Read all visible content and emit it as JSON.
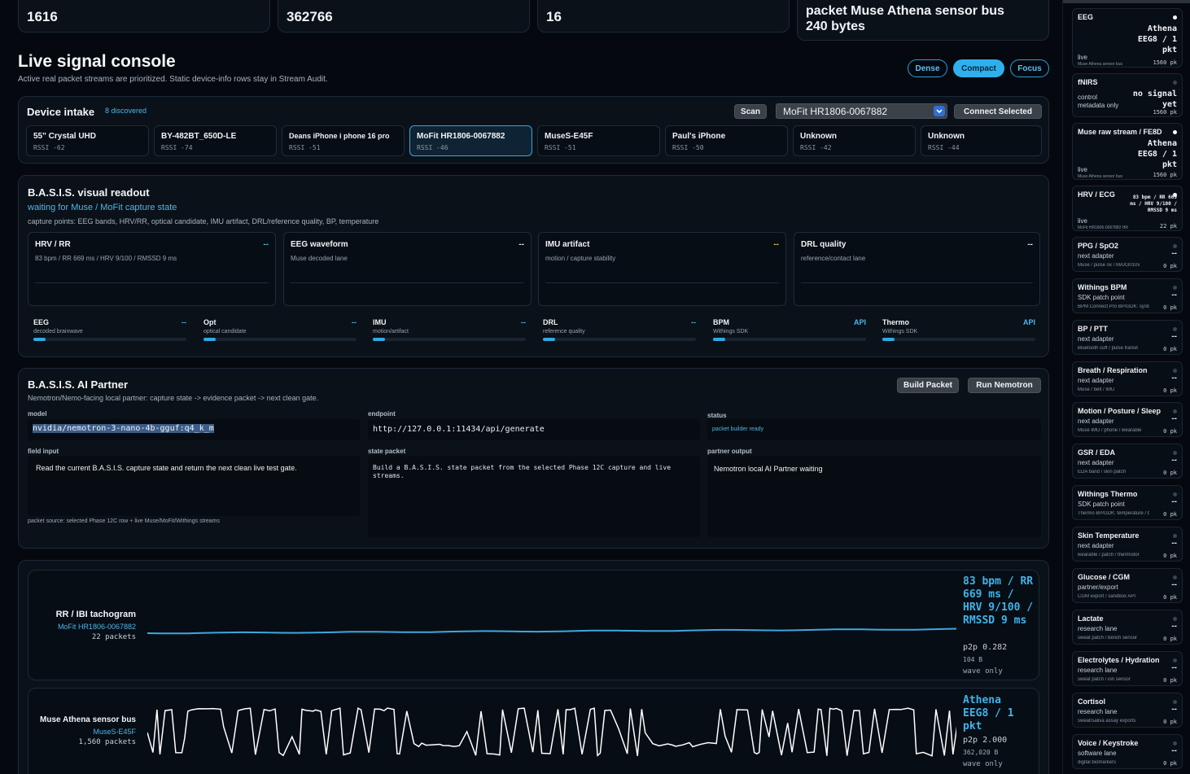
{
  "stats": [
    {
      "value": "1616"
    },
    {
      "value": "362766"
    },
    {
      "value": "16"
    }
  ],
  "last_packet": {
    "line1": "packet Muse Athena sensor bus",
    "line2": "240 bytes"
  },
  "header": {
    "title": "Live signal console",
    "subtitle": "Active real packet streams are prioritized. Static device-info rows stay in Stream Audit."
  },
  "view_modes": {
    "dense": "Dense",
    "compact": "Compact",
    "focus": "Focus",
    "active": "Compact"
  },
  "intake": {
    "title": "Device intake",
    "discovered": "8 discovered",
    "scan_label": "Scan",
    "selected_device": "MoFit HR1806-0067882",
    "connect_label": "Connect Selected",
    "devices": [
      {
        "name": "55\" Crystal UHD",
        "rssi": "RSSI -62"
      },
      {
        "name": "BY-482BT_650D-LE",
        "rssi": "RSSI -74"
      },
      {
        "name": "Deans iPhone i phone 16 pro",
        "rssi": "RSSI -51"
      },
      {
        "name": "MoFit HR1806-0067882",
        "rssi": "RSSI -46",
        "selected": true
      },
      {
        "name": "MuseS-E45F",
        "rssi": "RSSI -51"
      },
      {
        "name": "Paul's iPhone",
        "rssi": "RSSI -50"
      },
      {
        "name": "Unknown",
        "rssi": "RSSI -42"
      },
      {
        "name": "Unknown",
        "rssi": "RSSI -44"
      }
    ]
  },
  "visual": {
    "title": "B.A.S.I.S. visual readout",
    "state": "waiting for Muse / MoFit capture state",
    "capture_points": "capture points: EEG bands, HRV/RR, optical candidate, IMU artifact, DRL/reference quality, BP, temperature",
    "lanes": [
      {
        "title": "HRV / RR",
        "sub": "83 bpm / RR 669 ms / HRV 9/100 / RMSSD 9 ms",
        "value": "--"
      },
      {
        "title": "EEG waveform",
        "sub": "Muse decoded lane",
        "value": "--"
      },
      {
        "title": "IMU artifact",
        "sub": "motion / capture stability",
        "value": "--"
      },
      {
        "title": "DRL quality",
        "sub": "reference/contact lane",
        "value": "--"
      }
    ],
    "metrics": [
      {
        "title": "EEG",
        "sub": "decoded brainwave",
        "value": "--",
        "level": 0.08
      },
      {
        "title": "Opt",
        "sub": "optical candidate",
        "value": "--",
        "level": 0.08
      },
      {
        "title": "IMU",
        "sub": "motion/artifact",
        "value": "--",
        "level": 0.08
      },
      {
        "title": "DRL",
        "sub": "reference quality",
        "value": "--",
        "level": 0.08
      },
      {
        "title": "BPM",
        "sub": "Withings SDK",
        "value": "API",
        "level": 0.08
      },
      {
        "title": "Thermo",
        "sub": "Withings SDK",
        "value": "API",
        "level": 0.08
      }
    ]
  },
  "partner": {
    "title": "B.A.S.I.S. AI Partner",
    "build_label": "Build Packet",
    "run_label": "Run Nemotron",
    "subtitle": "Nemotron/Nemo-facing local partner: capture state -> evidence packet -> next clean gate.",
    "model_label": "model",
    "model": "nvidia/nemotron-3-nano-4b-gguf:q4_k_m",
    "endpoint_label": "endpoint",
    "endpoint": "http://127.0.0.1:11434/api/generate",
    "status_label": "status",
    "status": "packet builder ready",
    "field_input_label": "field input",
    "field_input": "Read the current B.A.S.I.S. capture state and return the next clean live test gate.",
    "state_packet_label": "state packet",
    "state_packet": "Build a B.A.S.I.S. state packet from the selected Phase 12C capture and live streams.",
    "output_label": "partner output",
    "output": "Nemotron local AI Partner waiting",
    "source": "packet source: selected Phase 12C row + live Muse/MoFit/Withings streams"
  },
  "streams": [
    {
      "title": "RR / IBI tachogram",
      "device": "MoFit HR1806-0067882",
      "packets": "22 packets",
      "readout": "83 bpm / RR 669 ms / HRV 9/100 / RMSSD 9 ms",
      "p2p": "p2p 0.282",
      "bytes": "104 B",
      "mode": "wave only"
    },
    {
      "title": "Muse Athena sensor bus",
      "device": "MuseS-E45F",
      "packets": "1,560 packets",
      "readout": "Athena EEG8 / 1 pkt",
      "p2p": "p2p 2.000",
      "bytes": "362,020 B",
      "mode": "wave only"
    }
  ],
  "sidebar": [
    {
      "title": "EEG",
      "status": "live",
      "value": "Athena EEG8 / 1 pkt",
      "sub": "Muse Athena sensor bus",
      "pk": "1560 pk",
      "on": true
    },
    {
      "title": "fNIRS",
      "status": "control metadata only",
      "value": "no signal yet",
      "sub": "",
      "pk": "1560 pk",
      "on": false
    },
    {
      "title": "Muse raw stream / FE8D",
      "status": "live",
      "value": "Athena EEG8 / 1 pkt",
      "sub": "Muse Athena sensor bus",
      "pk": "1560 pk",
      "on": true
    },
    {
      "title": "HRV / ECG",
      "status": "live",
      "value": "83 bpm / RR 669 ms / HRV 9/100 / RMSSD 9 ms",
      "sub": "MoFit HR1806-0067882 HR",
      "pk": "22 pk",
      "on": true
    },
    {
      "title": "PPG / SpO2",
      "status": "next adapter",
      "value": "--",
      "sub": "Muse / pulse ox / MAX3010x",
      "pk": "0 pk",
      "on": false
    },
    {
      "title": "Withings BPM",
      "status": "SDK patch point",
      "value": "--",
      "sub": "BPM Connect Pro BP/GDK: systolic / diastolic / pulse",
      "pk": "0 pk",
      "on": false
    },
    {
      "title": "BP / PTT",
      "status": "next adapter",
      "value": "--",
      "sub": "Bluetooth cuff / pulse transit",
      "pk": "0 pk",
      "on": false
    },
    {
      "title": "Breath / Respiration",
      "status": "next adapter",
      "value": "--",
      "sub": "Muse / belt / IMU",
      "pk": "0 pk",
      "on": false
    },
    {
      "title": "Motion / Posture / Sleep",
      "status": "next adapter",
      "value": "--",
      "sub": "Muse IMU / phone / wearable",
      "pk": "0 pk",
      "on": false
    },
    {
      "title": "GSR / EDA",
      "status": "next adapter",
      "value": "--",
      "sub": "EDA band / skin patch",
      "pk": "0 pk",
      "on": false
    },
    {
      "title": "Withings Thermo",
      "status": "SDK patch point",
      "value": "--",
      "sub": "Thermo BP/GDK: temperature / body temp / skin",
      "pk": "0 pk",
      "on": false
    },
    {
      "title": "Skin Temperature",
      "status": "next adapter",
      "value": "--",
      "sub": "wearable / patch / thermistor",
      "pk": "0 pk",
      "on": false
    },
    {
      "title": "Glucose / CGM",
      "status": "partner/export",
      "value": "--",
      "sub": "CGM export / sandbox API",
      "pk": "0 pk",
      "on": false
    },
    {
      "title": "Lactate",
      "status": "research lane",
      "value": "--",
      "sub": "sweat patch / bench sensor",
      "pk": "0 pk",
      "on": false
    },
    {
      "title": "Electrolytes / Hydration",
      "status": "research lane",
      "value": "--",
      "sub": "sweat patch / ion sensor",
      "pk": "0 pk",
      "on": false
    },
    {
      "title": "Cortisol",
      "status": "research lane",
      "value": "--",
      "sub": "sweat/saliva assay exports",
      "pk": "0 pk",
      "on": false
    },
    {
      "title": "Voice / Keystroke",
      "status": "software lane",
      "value": "--",
      "sub": "digital biomarkers",
      "pk": "0 pk",
      "on": false
    }
  ],
  "colors": {
    "accent": "#2fb0ec",
    "wave": "#3ea8e0",
    "bg": "#05090f"
  }
}
